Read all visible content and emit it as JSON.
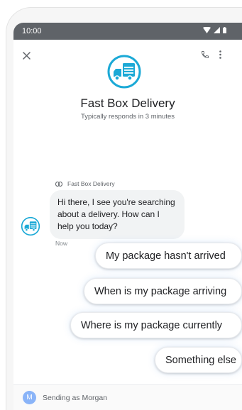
{
  "status_bar": {
    "time": "10:00"
  },
  "agent": {
    "name": "Fast Box Delivery",
    "subtitle": "Typically responds in 3 minutes",
    "brand_color": "#1ba9d6"
  },
  "conversation": {
    "sender_label": "Fast Box Delivery",
    "message": "Hi there, I see you're searching about a delivery. How can I help you today?",
    "timestamp": "Now"
  },
  "suggestions": [
    {
      "label": "My package hasn't arrived"
    },
    {
      "label": "When is my package arriving"
    },
    {
      "label": "Where is my package currently"
    },
    {
      "label": "Something else"
    }
  ],
  "compose": {
    "initial": "M",
    "sending_as": "Sending as Morgan"
  }
}
